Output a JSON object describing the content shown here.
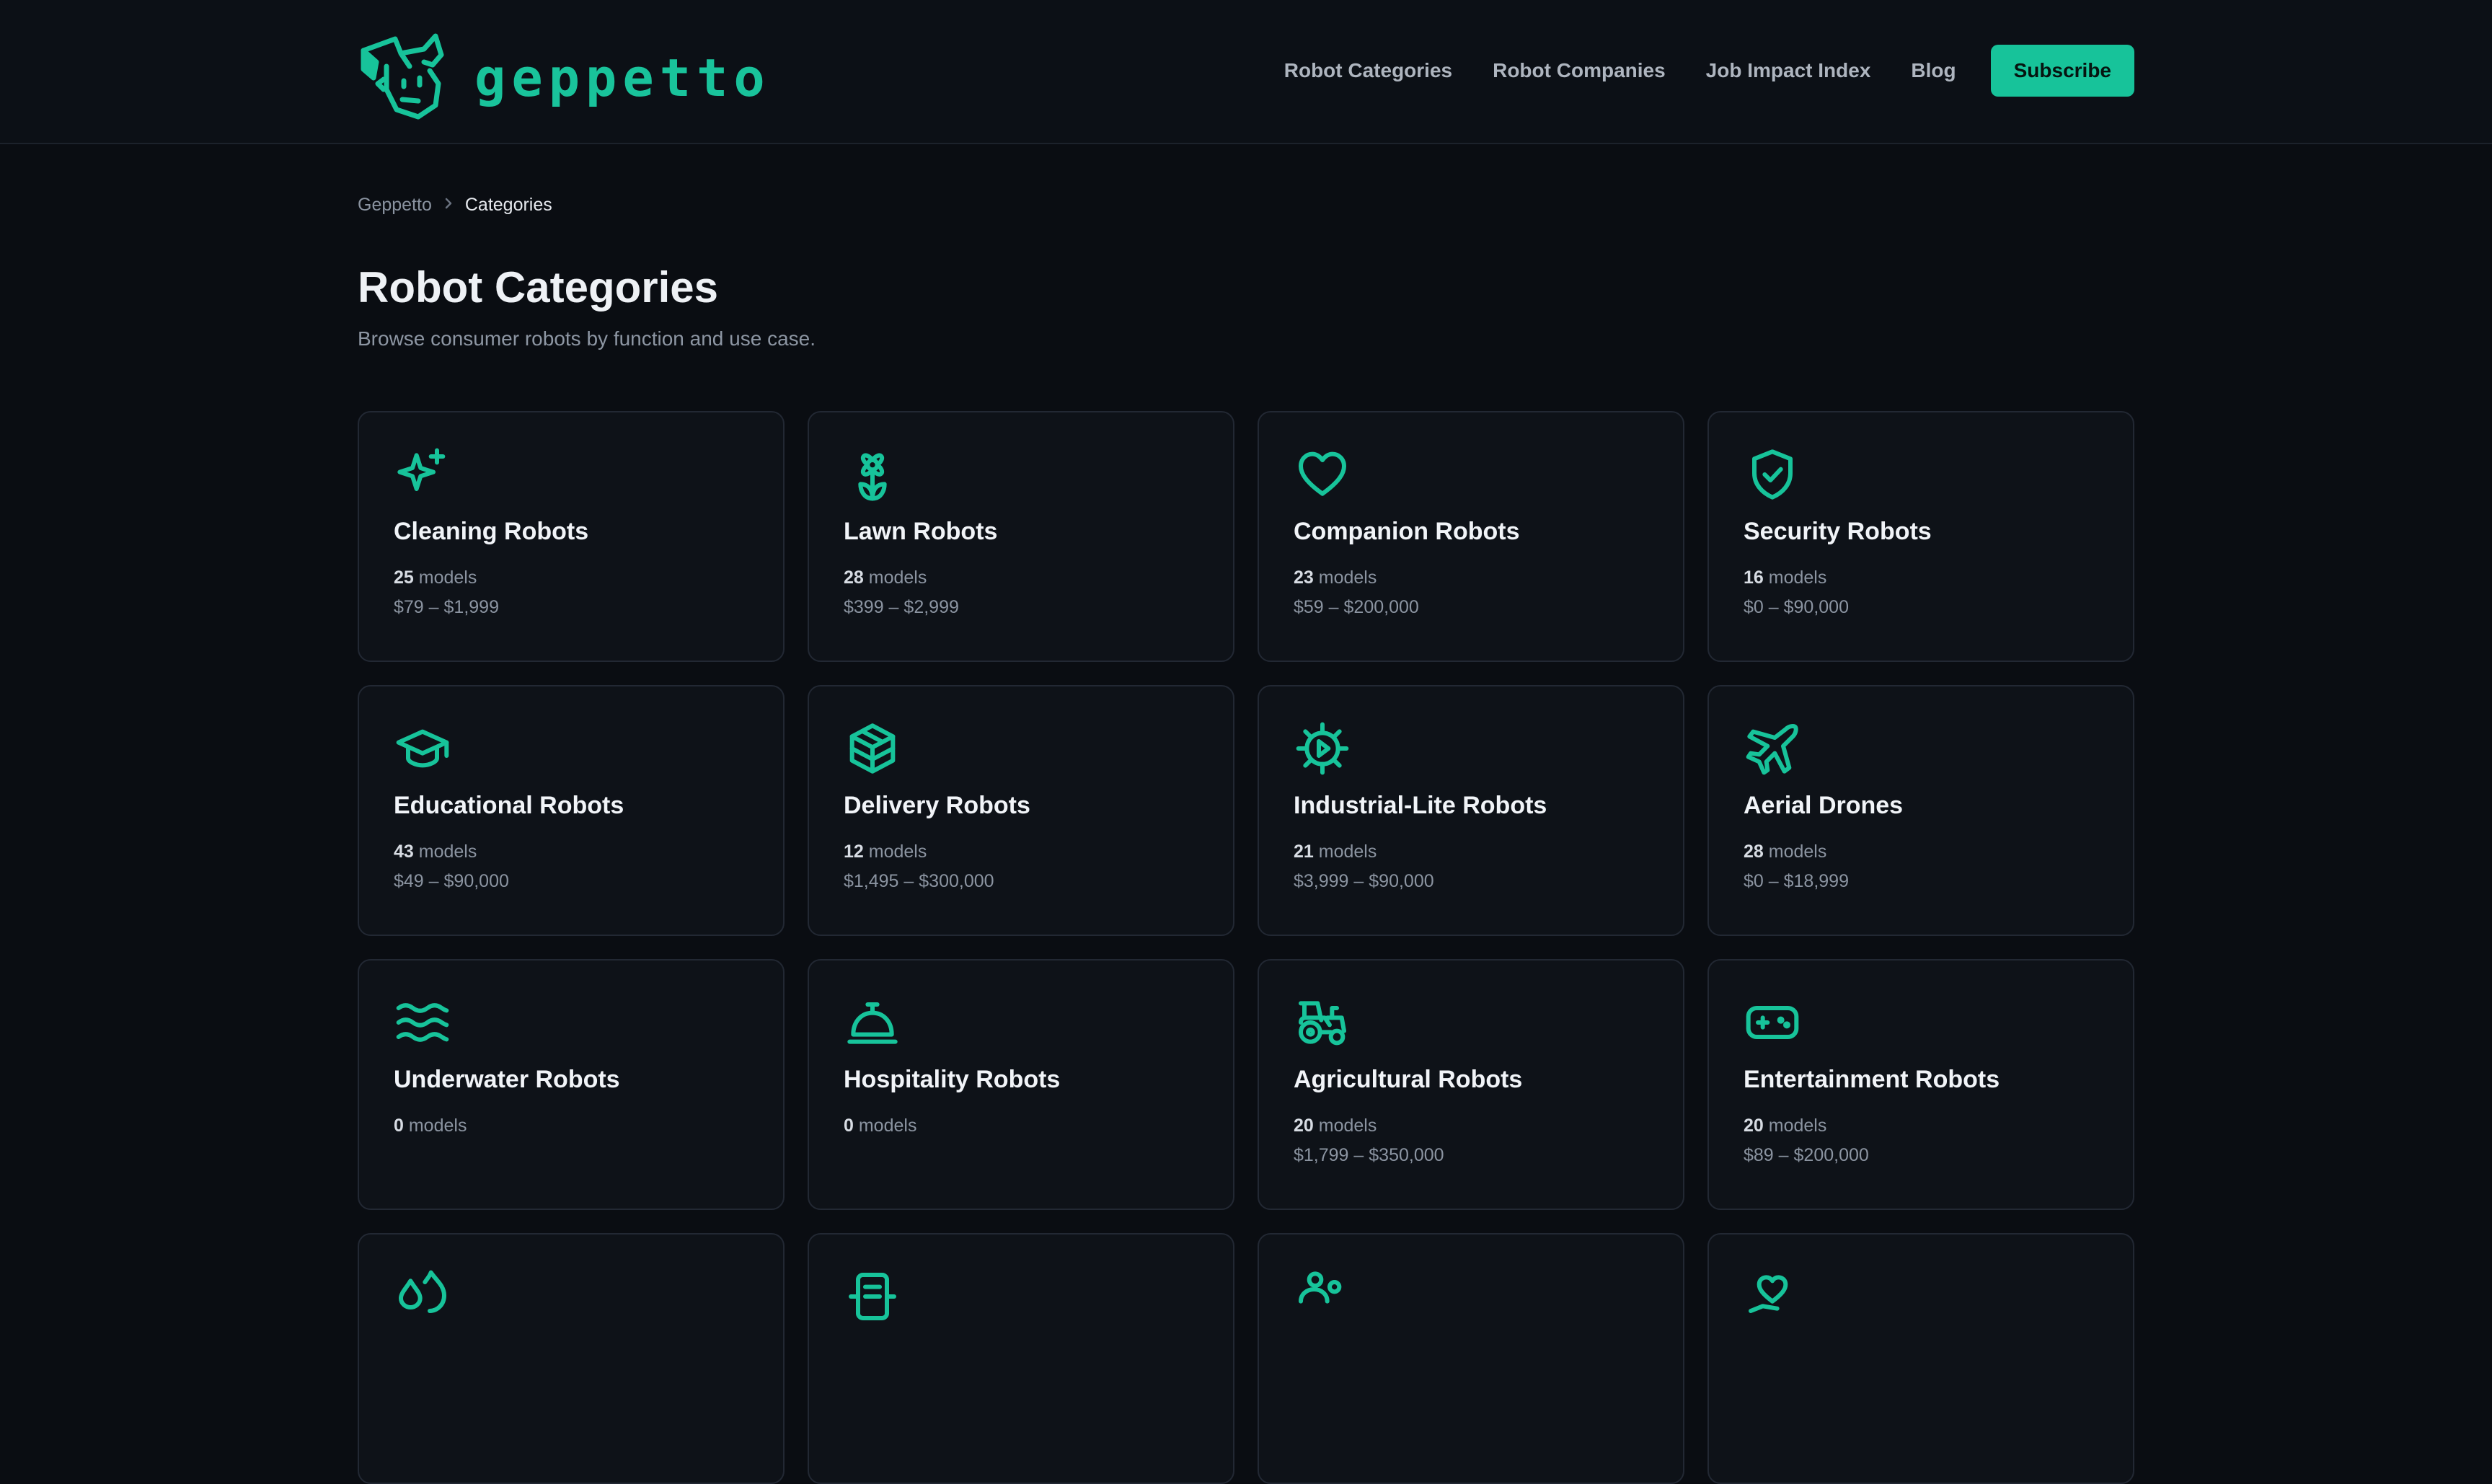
{
  "brand": {
    "name": "geppetto",
    "accent": "#17c39a"
  },
  "nav": {
    "items": [
      "Robot Categories",
      "Robot Companies",
      "Job Impact Index",
      "Blog"
    ],
    "subscribe_label": "Subscribe"
  },
  "breadcrumb": {
    "root": "Geppetto",
    "current": "Categories"
  },
  "page": {
    "title": "Robot Categories",
    "subtitle": "Browse consumer robots by function and use case."
  },
  "categories": [
    {
      "name": "Cleaning Robots",
      "count": "25",
      "count_label": "models",
      "price": "$79 – $1,999",
      "icon": "sparkles-icon"
    },
    {
      "name": "Lawn Robots",
      "count": "28",
      "count_label": "models",
      "price": "$399 – $2,999",
      "icon": "flower-icon"
    },
    {
      "name": "Companion Robots",
      "count": "23",
      "count_label": "models",
      "price": "$59 – $200,000",
      "icon": "heart-icon"
    },
    {
      "name": "Security Robots",
      "count": "16",
      "count_label": "models",
      "price": "$0 – $90,000",
      "icon": "shield-check-icon"
    },
    {
      "name": "Educational Robots",
      "count": "43",
      "count_label": "models",
      "price": "$49 – $90,000",
      "icon": "graduation-cap-icon"
    },
    {
      "name": "Delivery Robots",
      "count": "12",
      "count_label": "models",
      "price": "$1,495 – $300,000",
      "icon": "package-icon"
    },
    {
      "name": "Industrial-Lite Robots",
      "count": "21",
      "count_label": "models",
      "price": "$3,999 – $90,000",
      "icon": "gear-play-icon"
    },
    {
      "name": "Aerial Drones",
      "count": "28",
      "count_label": "models",
      "price": "$0 – $18,999",
      "icon": "plane-icon"
    },
    {
      "name": "Underwater Robots",
      "count": "0",
      "count_label": "models",
      "price": "",
      "icon": "waves-icon"
    },
    {
      "name": "Hospitality Robots",
      "count": "0",
      "count_label": "models",
      "price": "",
      "icon": "service-bell-icon"
    },
    {
      "name": "Agricultural Robots",
      "count": "20",
      "count_label": "models",
      "price": "$1,799 – $350,000",
      "icon": "tractor-icon"
    },
    {
      "name": "Entertainment Robots",
      "count": "20",
      "count_label": "models",
      "price": "$89 – $200,000",
      "icon": "gamepad-icon"
    },
    {
      "name": "",
      "count": "",
      "count_label": "",
      "price": "",
      "icon": "droplets-icon"
    },
    {
      "name": "",
      "count": "",
      "count_label": "",
      "price": "",
      "icon": "clipboard-icon"
    },
    {
      "name": "",
      "count": "",
      "count_label": "",
      "price": "",
      "icon": "bubbles-icon"
    },
    {
      "name": "",
      "count": "",
      "count_label": "",
      "price": "",
      "icon": "heart-hand-icon"
    }
  ]
}
